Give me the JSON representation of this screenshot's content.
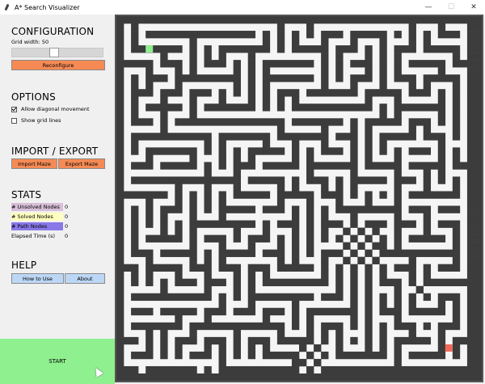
{
  "window": {
    "title": "A* Search Visualizer",
    "minimize": "—",
    "maximize": "☐",
    "close": "✕"
  },
  "config": {
    "title": "CONFIGURATION",
    "grid_width_label": "Grid width: 50",
    "grid_width": 50,
    "slider_fraction": 0.45,
    "reconfigure_label": "Reconfigure"
  },
  "options": {
    "title": "OPTIONS",
    "diagonal_label": "Allow diagonal movement",
    "diagonal_checked": true,
    "gridlines_label": "Show grid lines",
    "gridlines_checked": false
  },
  "import_export": {
    "title": "IMPORT / EXPORT",
    "import_label": "Import Maze",
    "export_label": "Export Maze"
  },
  "stats": {
    "title": "STATS",
    "rows": [
      {
        "label": "# Unsolved Nodes",
        "value": "0",
        "color": "#d8bfd8"
      },
      {
        "label": "# Solved Nodes",
        "value": "0",
        "color": "#ffffc0"
      },
      {
        "label": "# Path Nodes",
        "value": "0",
        "color": "#8878e8"
      },
      {
        "label": "Elapsed Time (s)",
        "value": "0",
        "color": "transparent"
      }
    ]
  },
  "help": {
    "title": "HELP",
    "how_to_label": "How to Use",
    "about_label": "About"
  },
  "start_label": "START",
  "colors": {
    "wall": "#3c3c3c",
    "open": "#f5f5f5",
    "start": "#90ee90",
    "goal": "#f06a5a"
  },
  "maze": {
    "cells": 50,
    "start_cell": [
      4,
      4
    ],
    "goal_cell": [
      45,
      45
    ],
    "seed": 1337
  }
}
